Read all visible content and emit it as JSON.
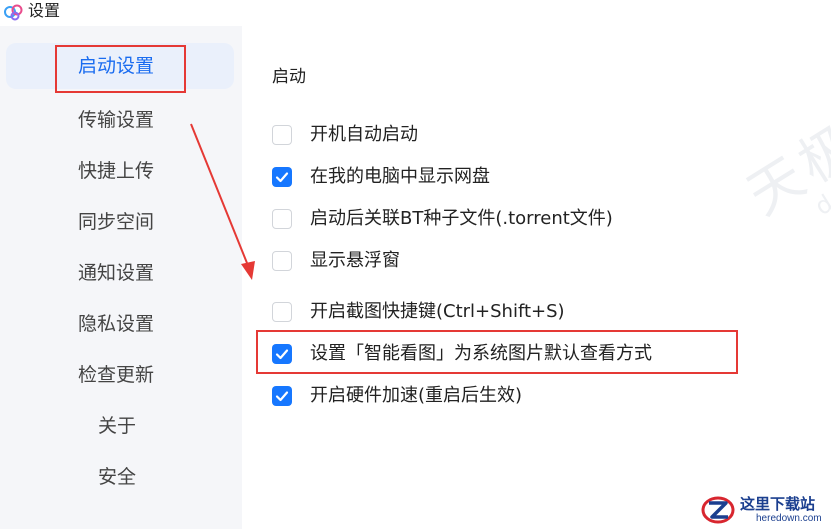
{
  "window": {
    "title": "设置"
  },
  "sidebar": {
    "items": [
      {
        "label": "启动设置"
      },
      {
        "label": "传输设置"
      },
      {
        "label": "快捷上传"
      },
      {
        "label": "同步空间"
      },
      {
        "label": "通知设置"
      },
      {
        "label": "隐私设置"
      },
      {
        "label": "检查更新"
      },
      {
        "label": "关于"
      },
      {
        "label": "安全"
      }
    ],
    "active_index": 0
  },
  "main": {
    "section_title": "启动",
    "options": [
      {
        "label": "开机自动启动",
        "checked": false
      },
      {
        "label": "在我的电脑中显示网盘",
        "checked": true
      },
      {
        "label": "启动后关联BT种子文件(.torrent文件)",
        "checked": false
      },
      {
        "label": "显示悬浮窗",
        "checked": false
      },
      {
        "label": "开启截图快捷键(Ctrl+Shift+S)",
        "checked": false
      },
      {
        "label": "设置「智能看图」为系统图片默认查看方式",
        "checked": true
      },
      {
        "label": "开启硬件加速(重启后生效)",
        "checked": true
      }
    ]
  },
  "watermark": {
    "text": "天极下载站",
    "url": "down.yesky.com"
  },
  "brand": {
    "name": "这里下载站",
    "url": "heredown.com"
  },
  "colors": {
    "accent": "#1677ff",
    "annotation": "#e53935",
    "active_bg": "#eaf0fb"
  }
}
